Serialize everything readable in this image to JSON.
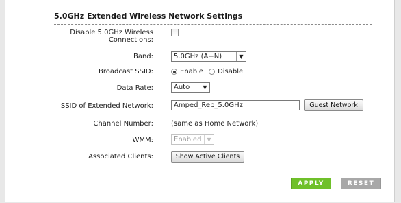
{
  "section": {
    "title": "5.0GHz Extended Wireless Network Settings"
  },
  "disable": {
    "label_line1": "Disable 5.0GHz Wireless",
    "label_line2": "Connections:",
    "checked": false
  },
  "band": {
    "label": "Band:",
    "value": "5.0GHz (A+N)"
  },
  "broadcast": {
    "label": "Broadcast SSID:",
    "enable": "Enable",
    "disable": "Disable",
    "selected": "Enable"
  },
  "datarate": {
    "label": "Data Rate:",
    "value": "Auto"
  },
  "ssid": {
    "label": "SSID of Extended Network:",
    "value": "Amped_Rep_5.0GHz",
    "guest_button": "Guest Network"
  },
  "channel": {
    "label": "Channel Number:",
    "value": "(same as Home Network)"
  },
  "wmm": {
    "label": "WMM:",
    "value": "Enabled"
  },
  "clients": {
    "label": "Associated Clients:",
    "button": "Show Active Clients"
  },
  "actions": {
    "apply": "APPLY",
    "reset": "RESET"
  },
  "colors": {
    "apply_bg": "#6fc02a",
    "reset_bg": "#a8a8a8"
  },
  "icons": {
    "dropdown": "chevron-down-icon"
  }
}
